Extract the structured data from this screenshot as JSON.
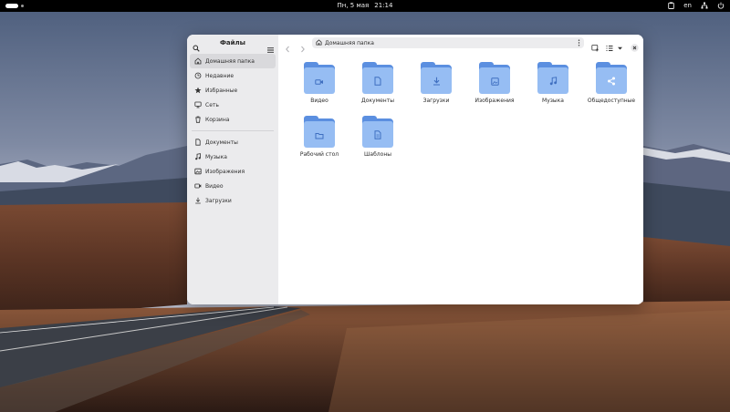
{
  "topbar": {
    "date": "Пн, 5 мая",
    "time": "21:14",
    "language": "en",
    "icons": [
      "clipboard-icon",
      "network-icon",
      "power-icon"
    ]
  },
  "window": {
    "sidebar": {
      "title": "Файлы",
      "places": [
        {
          "label": "Домашняя папка",
          "icon": "home-icon",
          "active": true
        },
        {
          "label": "Недавние",
          "icon": "recent-icon"
        },
        {
          "label": "Избранные",
          "icon": "star-icon"
        },
        {
          "label": "Сеть",
          "icon": "network-icon"
        },
        {
          "label": "Корзина",
          "icon": "trash-icon"
        }
      ],
      "bookmarks": [
        {
          "label": "Документы",
          "icon": "document-icon"
        },
        {
          "label": "Музыка",
          "icon": "music-icon"
        },
        {
          "label": "Изображения",
          "icon": "image-icon"
        },
        {
          "label": "Видео",
          "icon": "video-icon"
        },
        {
          "label": "Загрузки",
          "icon": "download-icon"
        }
      ]
    },
    "path": {
      "current": "Домашняя папка"
    },
    "folders": [
      {
        "label": "Видео",
        "icon": "video-icon"
      },
      {
        "label": "Документы",
        "icon": "document-icon"
      },
      {
        "label": "Загрузки",
        "icon": "download-icon"
      },
      {
        "label": "Изображения",
        "icon": "image-icon"
      },
      {
        "label": "Музыка",
        "icon": "music-icon"
      },
      {
        "label": "Общедоступные",
        "icon": "share-icon"
      },
      {
        "label": "Рабочий стол",
        "icon": "desktop-icon"
      },
      {
        "label": "Шаблоны",
        "icon": "template-icon"
      }
    ],
    "colors": {
      "folder_back": "#5b8fe0",
      "folder_front": "#96bdf3",
      "folder_glyph": "#3f6fc0"
    }
  }
}
